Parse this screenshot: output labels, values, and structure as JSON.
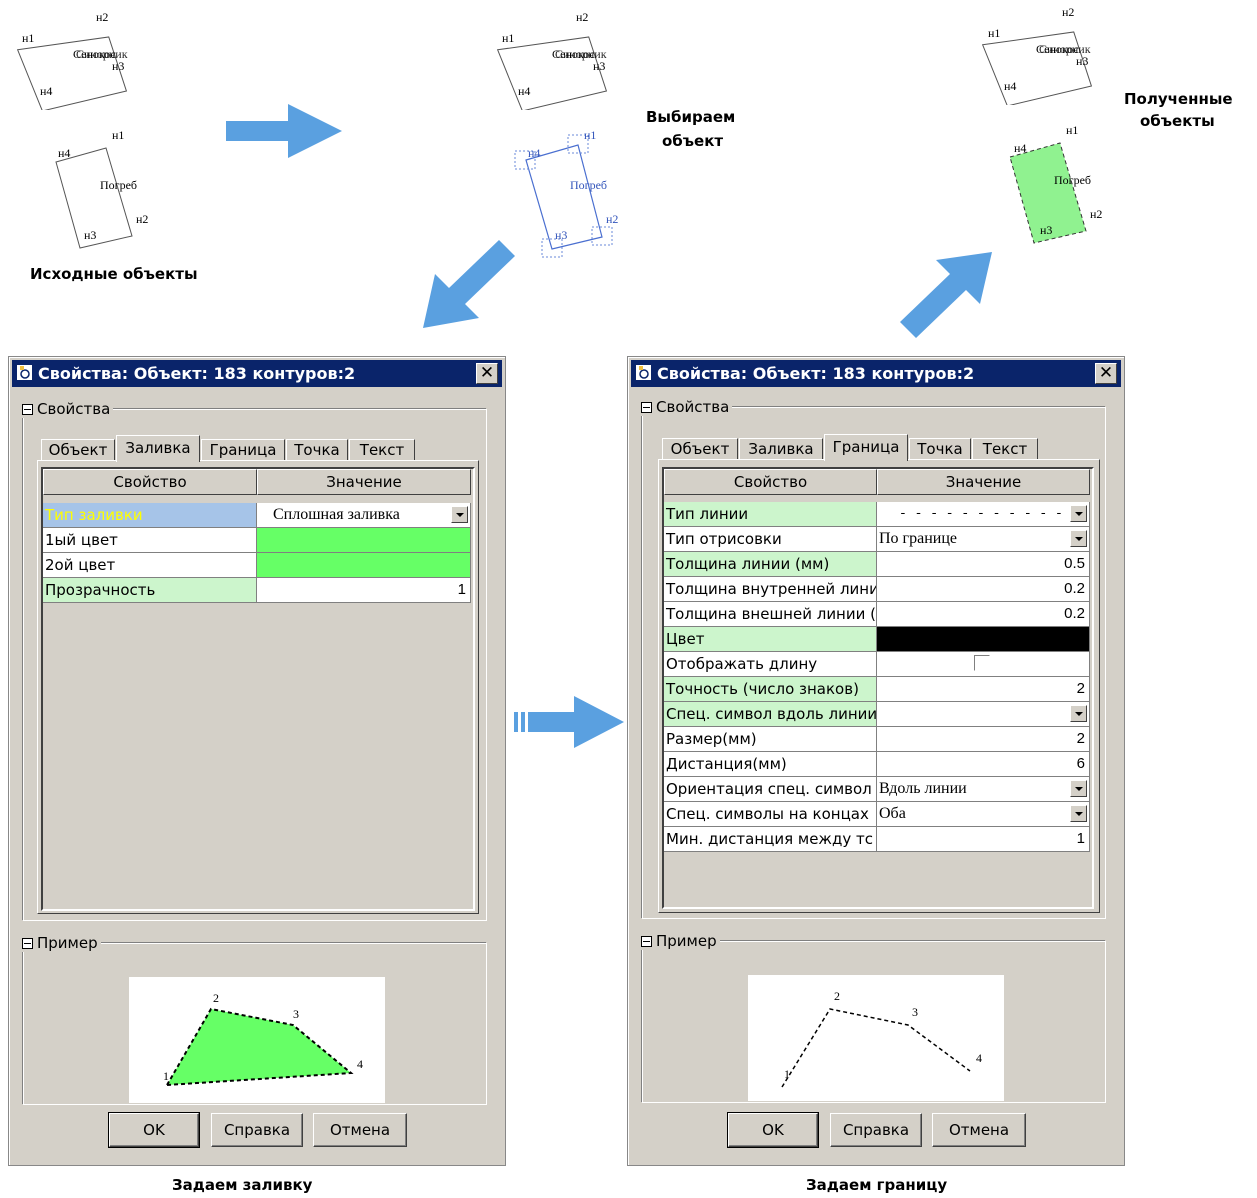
{
  "scenes": {
    "source": {
      "caption": "Исходные объекты",
      "barn_labels": [
        "н1",
        "н2",
        "Сенокос",
        "Синорник",
        "н3",
        "н4"
      ],
      "cellar_labels": [
        "н1",
        "н4",
        "Погреб",
        "н2",
        "н3"
      ]
    },
    "select": {
      "caption_line1": "Выбираем",
      "caption_line2": "объект",
      "barn_labels": [
        "н1",
        "н2",
        "Сенокос",
        "Синорник",
        "н3",
        "н4"
      ],
      "cellar_labels": [
        "н1",
        "н4",
        "Погреб",
        "н2",
        "н3"
      ]
    },
    "result": {
      "caption_line1": "Полученные",
      "caption_line2": "объекты",
      "barn_labels": [
        "н1",
        "н2",
        "Сенокос",
        "Синорник",
        "н3",
        "н4"
      ],
      "cellar_labels": [
        "н1",
        "н4",
        "Погреб",
        "н2",
        "н3"
      ],
      "fill_color": "#90f290"
    }
  },
  "arrow_color": "#5aa0e0",
  "dialog_fill": {
    "title": "Свойства: Объект: 183 контуров:2",
    "close_glyph": "✕",
    "group_props": "Свойства",
    "tabs": [
      "Объект",
      "Заливка",
      "Граница",
      "Точка",
      "Текст"
    ],
    "active_tab": "Заливка",
    "col_property": "Свойство",
    "col_value": "Значение",
    "rows": [
      {
        "name": "Тип заливки",
        "value": "Сплошная заливка"
      },
      {
        "name": "1ый цвет",
        "value": ""
      },
      {
        "name": "2ой цвет",
        "value": ""
      },
      {
        "name": "Прозрачность",
        "value": "1"
      }
    ],
    "color1": "#66ff66",
    "color2": "#66ff66",
    "group_example": "Пример",
    "preview_points": [
      "1",
      "2",
      "3",
      "4"
    ],
    "btn_ok": "OK",
    "btn_help": "Справка",
    "btn_cancel": "Отмена",
    "caption": "Задаем заливку"
  },
  "dialog_border": {
    "title": "Свойства: Объект: 183 контуров:2",
    "close_glyph": "✕",
    "group_props": "Свойства",
    "tabs": [
      "Объект",
      "Заливка",
      "Граница",
      "Точка",
      "Текст"
    ],
    "active_tab": "Граница",
    "col_property": "Свойство",
    "col_value": "Значение",
    "rows": [
      {
        "name": "Тип линии",
        "value": "- - - - - - - - - - - -"
      },
      {
        "name": "Тип отрисовки",
        "value": "По границе"
      },
      {
        "name": "Толщина линии (мм)",
        "value": "0.5"
      },
      {
        "name": "Толщина внутренней лини",
        "value": "0.2"
      },
      {
        "name": "Толщина внешней линии (",
        "value": "0.2"
      },
      {
        "name": "Цвет",
        "value": ""
      },
      {
        "name": "Отображать длину",
        "value": ""
      },
      {
        "name": "Точность (число знаков)",
        "value": "2"
      },
      {
        "name": "Спец. символ вдоль линии",
        "value": ""
      },
      {
        "name": "Размер(мм)",
        "value": "2"
      },
      {
        "name": "Дистанция(мм)",
        "value": "6"
      },
      {
        "name": "Ориентация спец. символ",
        "value": "Вдоль линии"
      },
      {
        "name": "Спец. символы на концах",
        "value": "Оба"
      },
      {
        "name": "Мин. дистанция между тс",
        "value": "1"
      }
    ],
    "color": "#000000",
    "group_example": "Пример",
    "preview_points": [
      "1",
      "2",
      "3",
      "4"
    ],
    "btn_ok": "OK",
    "btn_help": "Справка",
    "btn_cancel": "Отмена",
    "caption": "Задаем границу"
  }
}
